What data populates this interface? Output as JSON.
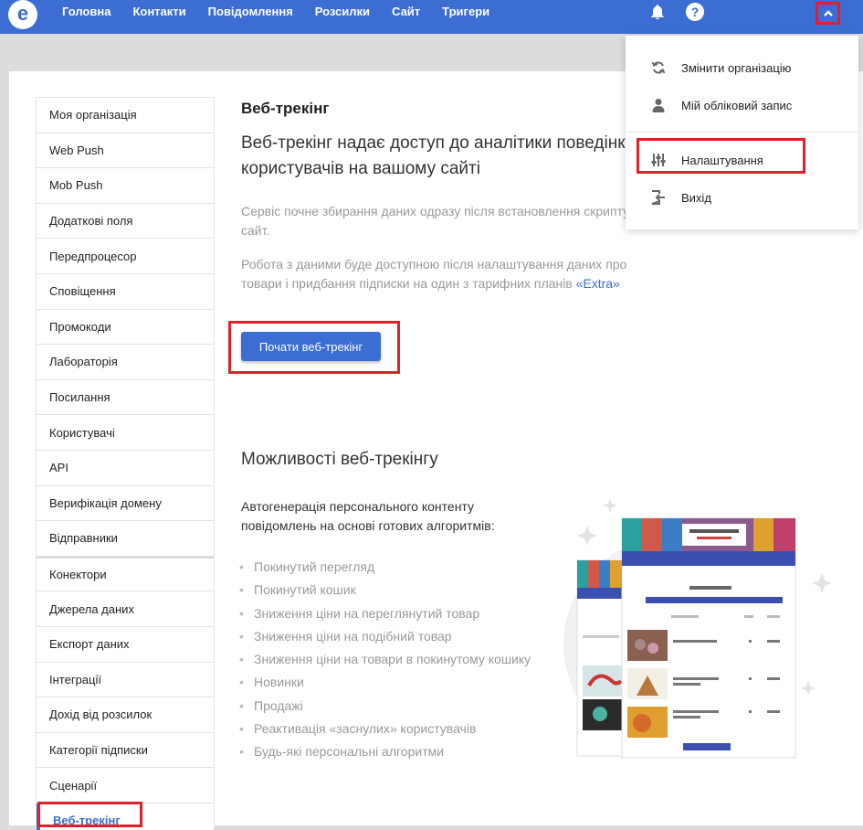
{
  "topbar": {
    "logo_letter": "e",
    "nav": [
      "Головна",
      "Контакти",
      "Повідомлення",
      "Розсилки",
      "Сайт",
      "Тригери"
    ],
    "help_label": "?"
  },
  "sidebar": {
    "items": [
      "Моя організація",
      "Web Push",
      "Mob Push",
      "Додаткові поля",
      "Передпроцесор",
      "Сповіщення",
      "Промокоди",
      "Лабораторія",
      "Посилання",
      "Користувачі",
      "API",
      "Верифікація домену",
      "Відправники",
      "Конектори",
      "Джерела даних",
      "Експорт даних",
      "Інтеграції",
      "Дохід від розсилок",
      "Категорії підписки",
      "Сценарії"
    ],
    "active_item": "Веб-трекінг"
  },
  "main": {
    "title": "Веб-трекінг",
    "lead": "Веб-трекінг надає доступ до аналітики поведінки користувачів на вашому сайті",
    "p1": "Сервіс почне збирання даних одразу після встановлення скрипту на сайт.",
    "p2_prefix": "Робота з даними буде доступною після налаштування даних про товари і придбання підписки на один з тарифних планів ",
    "p2_link": "«Extra»",
    "start_button": "Почати веб-трекінг",
    "features_title": "Можливості веб-трекінгу",
    "features_intro": "Автогенерація персонального контенту повідомлень на основі готових алгоритмів:",
    "features": [
      "Покинутий перегляд",
      "Покинутий кошик",
      "Зниження ціни на переглянутий товар",
      "Зниження ціни на подібний товар",
      "Зниження ціни на товари в покинутому кошику",
      "Новинки",
      "Продажі",
      "Реактивація «заснулих» користувачів",
      "Будь-які персональні алгоритми"
    ]
  },
  "dropdown": {
    "items": [
      {
        "label": "Змінити організацію",
        "icon": "sync-icon"
      },
      {
        "label": "Мій обліковий запис",
        "icon": "user-icon"
      },
      {
        "label": "Налаштування",
        "icon": "sliders-icon"
      },
      {
        "label": "Вихід",
        "icon": "logout-icon"
      }
    ]
  },
  "colors": {
    "brand": "#3b6dd2",
    "highlight": "#e0202a"
  }
}
